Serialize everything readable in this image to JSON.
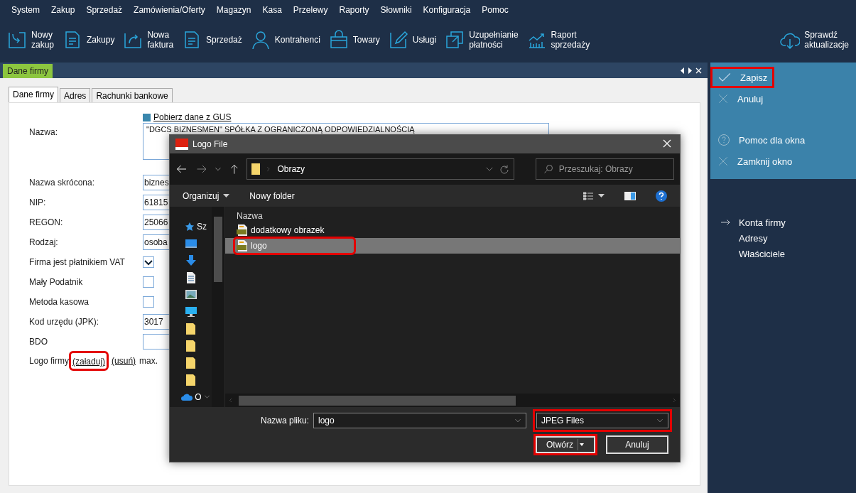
{
  "menu": [
    "System",
    "Zakup",
    "Sprzedaż",
    "Zamówienia/Oferty",
    "Magazyn",
    "Kasa",
    "Przelewy",
    "Raporty",
    "Słowniki",
    "Konfiguracja",
    "Pomoc"
  ],
  "toolbar": [
    {
      "label": "Nowy\nzakup"
    },
    {
      "label": "Zakupy"
    },
    {
      "label": "Nowa\nfaktura"
    },
    {
      "label": "Sprzedaż"
    },
    {
      "label": "Kontrahenci"
    },
    {
      "label": "Towary"
    },
    {
      "label": "Usługi"
    },
    {
      "label": "Uzupełnianie\npłatności"
    },
    {
      "label": "Raport\nsprzedaży"
    }
  ],
  "update_button": {
    "label": "Sprawdź\naktualizacje"
  },
  "document_tab": {
    "label": "Dane firmy",
    "selected": true
  },
  "inner_tabs": [
    {
      "label": "Dane firmy",
      "selected": true
    },
    {
      "label": "Adres",
      "selected": false
    },
    {
      "label": "Rachunki bankowe",
      "selected": false
    }
  ],
  "gus_link": "Pobierz dane z GUS",
  "form": [
    {
      "kind": "textarea",
      "label": "Nazwa:",
      "value": "\"DGCS BIZNESMEN\" SPÓŁKA Z OGRANICZONĄ ODPOWIEDZIALNOŚCIĄ"
    },
    {
      "kind": "text",
      "label": "Nazwa skrócona:",
      "value": "biznes"
    },
    {
      "kind": "text",
      "label": "NIP:",
      "value": "61815"
    },
    {
      "kind": "text",
      "label": "REGON:",
      "value": "25066"
    },
    {
      "kind": "text",
      "label": "Rodzaj:",
      "value": "osoba"
    },
    {
      "kind": "checkbox",
      "label": "Firma jest płatnikiem VAT",
      "checked": true
    },
    {
      "kind": "checkbox",
      "label": "Mały Podatnik",
      "checked": false
    },
    {
      "kind": "checkbox",
      "label": "Metoda kasowa",
      "checked": false
    },
    {
      "kind": "text",
      "label": "Kod urzędu (JPK):",
      "value": "3017"
    },
    {
      "kind": "text",
      "label": "BDO"
    }
  ],
  "logo_row": {
    "label": "Logo firmy",
    "load_link": "(załaduj)",
    "load_highlighted": true,
    "remove_link": "(usuń)",
    "note": "max."
  },
  "actions": [
    {
      "kind": "check",
      "label": "Zapisz",
      "highlighted": true
    },
    {
      "kind": "cross",
      "label": "Anuluj",
      "highlighted": false
    },
    {
      "kind": "help",
      "label": "Pomoc dla okna",
      "highlighted": false
    },
    {
      "kind": "cross",
      "label": "Zamknij okno",
      "highlighted": false
    }
  ],
  "links": [
    {
      "label": "Konta firmy",
      "arrow": true
    },
    {
      "label": "Adresy",
      "arrow": false
    },
    {
      "label": "Właściciele",
      "arrow": false
    }
  ],
  "dialog": {
    "title": "Logo File",
    "path": "Obrazy",
    "search_placeholder": "Przeszukaj: Obrazy",
    "organize": "Organizuj",
    "new_folder": "Nowy folder",
    "nav": [
      {
        "kind": "star",
        "label": "Sz"
      },
      {
        "kind": "desktop"
      },
      {
        "kind": "download"
      },
      {
        "kind": "document"
      },
      {
        "kind": "image"
      },
      {
        "kind": "monitor"
      },
      {
        "kind": "folder"
      },
      {
        "kind": "folder"
      },
      {
        "kind": "folder"
      },
      {
        "kind": "folder"
      },
      {
        "kind": "cloud",
        "label": "O"
      }
    ],
    "column": "Nazwa",
    "files": [
      {
        "name": "dodatkowy obrazek",
        "selected": false,
        "highlighted": false
      },
      {
        "name": "logo",
        "selected": true,
        "highlighted": true
      }
    ],
    "filename_label": "Nazwa pliku:",
    "filename": "logo",
    "filetype": "JPEG Files",
    "filetype_highlighted": true,
    "open": "Otwórz",
    "open_highlighted": true,
    "cancel": "Anuluj"
  }
}
